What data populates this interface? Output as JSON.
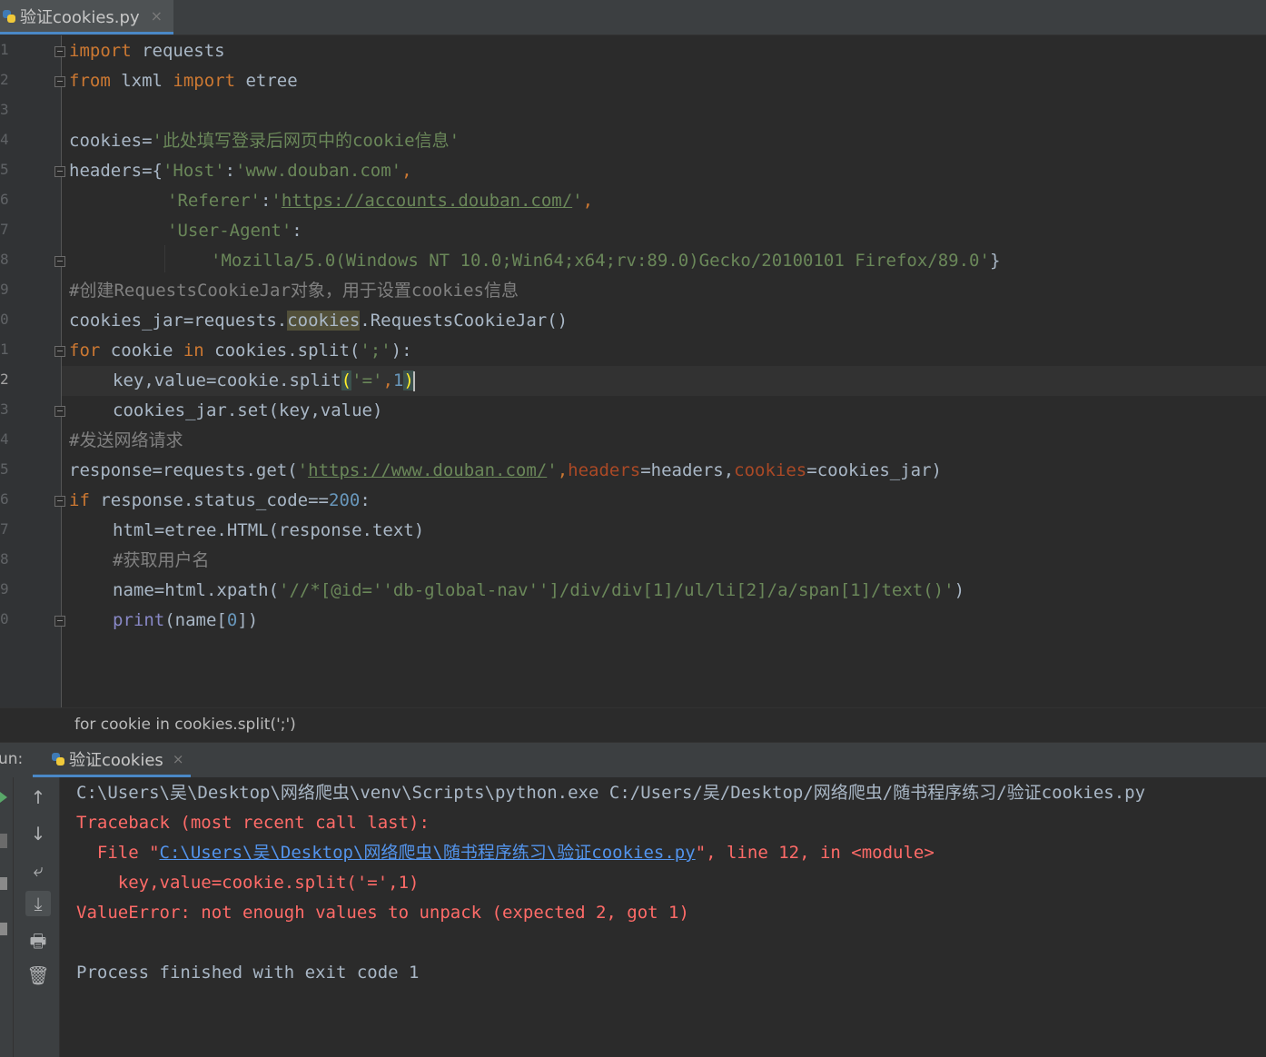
{
  "tab": {
    "label": "验证cookies.py",
    "close": "×"
  },
  "gutter": {
    "line_numbers": [
      "1",
      "2",
      "3",
      "4",
      "5",
      "6",
      "7",
      "8",
      "9",
      "0",
      "1",
      "2",
      "3",
      "4",
      "5",
      "6",
      "7",
      "8",
      "9",
      "0"
    ]
  },
  "code": {
    "l1": [
      "import",
      " requests"
    ],
    "l2": [
      "from",
      " lxml ",
      "import",
      " etree"
    ],
    "l4": [
      "cookies=",
      "'此处填写登录后网页中的cookie信息'"
    ],
    "l5": [
      "headers={",
      "'Host'",
      ":",
      "'www.douban.com'",
      ","
    ],
    "l6": [
      "'Referer'",
      ":",
      "'",
      "https://accounts.douban.com/",
      "'",
      ","
    ],
    "l7": [
      "'User-Agent'",
      ":"
    ],
    "l8": [
      "'Mozilla/5.0(Windows NT 10.0;Win64;x64;rv:89.0)Gecko/20100101 Firefox/89.0'",
      "}"
    ],
    "l9": "#创建RequestsCookieJar对象，用于设置cookies信息",
    "l10": [
      "cookies_jar=requests.",
      "cookies",
      ".RequestsCookieJar()"
    ],
    "l11": [
      "for",
      " cookie ",
      "in",
      " cookies.split(",
      "';'",
      "):"
    ],
    "l12": [
      "key,value=cookie.split",
      "(",
      "'='",
      ",",
      "1",
      ")"
    ],
    "l13": "cookies_jar.set(key,value)",
    "l14": "#发送网络请求",
    "l15": [
      "response=requests.get(",
      "'",
      "https://www.douban.com/",
      "'",
      ",",
      "headers",
      "=headers,",
      "cookies",
      "=cookies_jar)"
    ],
    "l16": [
      "if",
      " response.status_code==",
      "200",
      ":"
    ],
    "l17": "html=etree.HTML(response.text)",
    "l18": "#获取用户名",
    "l19": [
      "name=html.xpath(",
      "'//*[@id=''db-global-nav'']/div/div[1]/ul/li[2]/a/span[1]/text()'",
      ")"
    ],
    "l20": [
      "print",
      "(name[",
      "0",
      "])"
    ]
  },
  "breadcrumb": "for cookie in cookies.split(';')",
  "run": {
    "label": "un:",
    "tab_label": "验证cookies",
    "tab_close": "×",
    "output": {
      "cmd": "C:\\Users\\吴\\Desktop\\网络爬虫\\venv\\Scripts\\python.exe C:/Users/吴/Desktop/网络爬虫/随书程序练习/验证cookies.py",
      "traceback": "Traceback (most recent call last):",
      "file_prefix": "  File \"",
      "file_path": "C:\\Users\\吴\\Desktop\\网络爬虫\\随书程序练习\\验证cookies.py",
      "file_suffix": "\", line 12, in <module>",
      "src_line": "    key,value=cookie.split('=',1)",
      "error": "ValueError: not enough values to unpack (expected 2, got 1)",
      "exit": "Process finished with exit code 1"
    }
  },
  "icons": {
    "up": "↑",
    "down": "↓",
    "wrap": "⤶",
    "scroll_end": "⤓",
    "print": "🖶",
    "trash": "🗑"
  }
}
